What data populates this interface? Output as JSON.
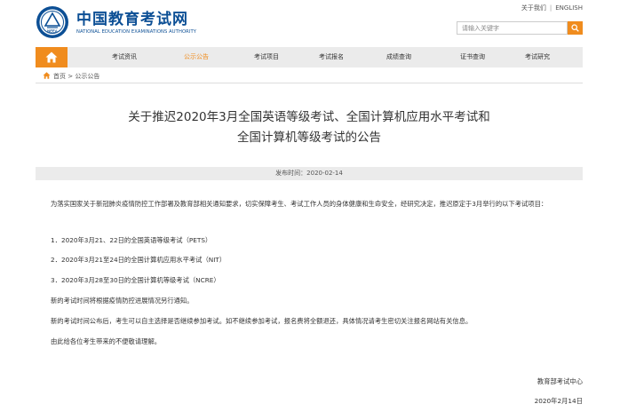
{
  "site": {
    "logo_text": "NEEA",
    "title": "中国教育考试网",
    "subtitle": "NATIONAL EDUCATION EXAMINATIONS AUTHORITY"
  },
  "toplinks": {
    "about": "关于我们",
    "english": "ENGLISH"
  },
  "search": {
    "placeholder": "请输入关键字"
  },
  "nav": {
    "items": [
      {
        "label": "考试资讯",
        "active": false
      },
      {
        "label": "公示公告",
        "active": true
      },
      {
        "label": "考试项目",
        "active": false
      },
      {
        "label": "考试报名",
        "active": false
      },
      {
        "label": "成绩查询",
        "active": false
      },
      {
        "label": "证书查询",
        "active": false
      },
      {
        "label": "考试研究",
        "active": false
      }
    ]
  },
  "breadcrumb": {
    "home": "首页",
    "sep": ">",
    "current": "公示公告"
  },
  "article": {
    "title_line1": "关于推迟2020年3月全国英语等级考试、全国计算机应用水平考试和",
    "title_line2": "全国计算机等级考试的公告",
    "date": "发布时间：2020-02-14",
    "intro": "为落实国家关于新冠肺炎疫情防控工作部署及教育部相关通知要求，切实保障考生、考试工作人员的身体健康和生命安全，经研究决定，推迟原定于3月举行的以下考试项目：",
    "items": [
      "1．2020年3月21、22日的全国英语等级考试（PETS）",
      "2．2020年3月21至24日的全国计算机应用水平考试（NIT）",
      "3．2020年3月28至30日的全国计算机等级考试（NCRE）"
    ],
    "p2": "新的考试时间将根据疫情防控进展情况另行通知。",
    "p3": "新的考试时间公布后，考生可以自主选择是否继续参加考试。如不继续参加考试，报名费将全额退还，具体情况请考生密切关注报名网站有关信息。",
    "p4": "由此给各位考生带来的不便敬请理解。",
    "signature": "教育部考试中心",
    "sign_date": "2020年2月14日"
  },
  "colors": {
    "accent": "#f08c1e",
    "brand": "#0c4f95",
    "nav_bg": "#ebebeb"
  }
}
